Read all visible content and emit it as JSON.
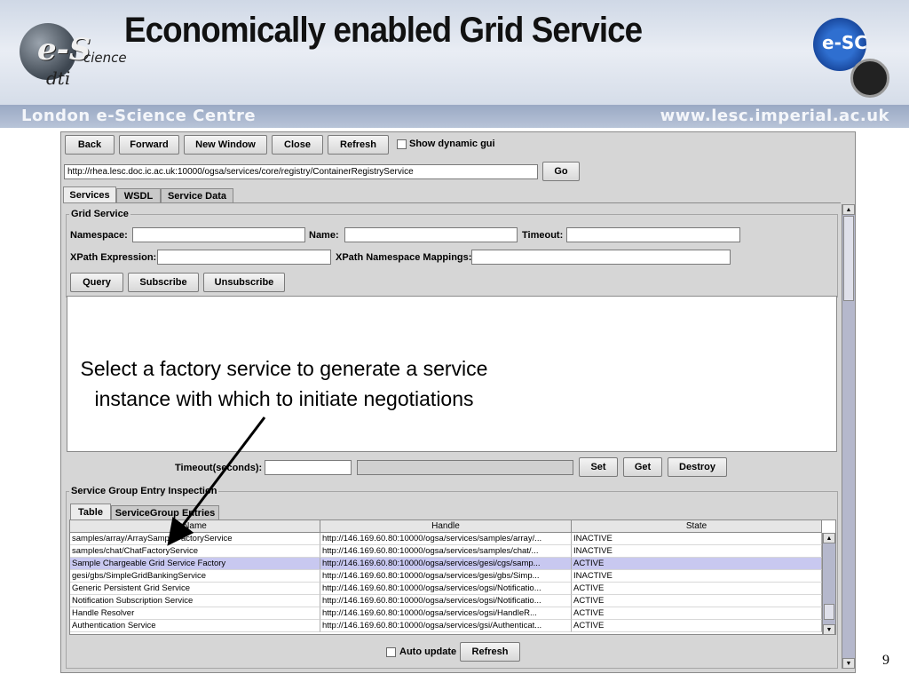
{
  "slide": {
    "title": "Economically enabled Grid Service",
    "strip_left": "London e-Science Centre",
    "strip_right": "www.lesc.imperial.ac.uk",
    "logo_left": {
      "es": "e-S",
      "cience": "cience",
      "dti": "dti"
    },
    "logo_right": {
      "esc": "e-SC",
      "icenitext": "ICENI"
    },
    "annotation_line1": "Select a factory service to generate a service",
    "annotation_line2": "instance with which to initiate negotiations",
    "page_number": "9"
  },
  "toolbar": {
    "back": "Back",
    "forward": "Forward",
    "new_window": "New Window",
    "close": "Close",
    "refresh": "Refresh",
    "show_dynamic_gui": "Show dynamic gui"
  },
  "address": {
    "url": "http://rhea.lesc.doc.ic.ac.uk:10000/ogsa/services/core/registry/ContainerRegistryService",
    "go": "Go"
  },
  "tabs": [
    "Services",
    "WSDL",
    "Service Data"
  ],
  "grid_service": {
    "title": "Grid Service",
    "namespace_label": "Namespace:",
    "name_label": "Name:",
    "timeout_label": "Timeout:",
    "xpath_label": "XPath Expression:",
    "xpath_ns_label": "XPath Namespace Mappings:",
    "query": "Query",
    "subscribe": "Subscribe",
    "unsubscribe": "Unsubscribe"
  },
  "timeout_bar": {
    "label": "Timeout(seconds):",
    "set": "Set",
    "get": "Get",
    "destroy": "Destroy"
  },
  "inspection": {
    "title": "Service Group Entry Inspection",
    "tabs": [
      "Table",
      "ServiceGroup Entries"
    ],
    "columns": [
      "Name",
      "Handle",
      "State"
    ],
    "rows": [
      {
        "name": "samples/array/ArraySampleFactoryService",
        "handle": "http://146.169.60.80:10000/ogsa/services/samples/array/...",
        "state": "INACTIVE"
      },
      {
        "name": "samples/chat/ChatFactoryService",
        "handle": "http://146.169.60.80:10000/ogsa/services/samples/chat/...",
        "state": "INACTIVE"
      },
      {
        "name": "Sample Chargeable Grid Service Factory",
        "handle": "http://146.169.60.80:10000/ogsa/services/gesi/cgs/samp...",
        "state": "ACTIVE"
      },
      {
        "name": "gesi/gbs/SimpleGridBankingService",
        "handle": "http://146.169.60.80:10000/ogsa/services/gesi/gbs/Simp...",
        "state": "INACTIVE"
      },
      {
        "name": "Generic Persistent Grid Service",
        "handle": "http://146.169.60.80:10000/ogsa/services/ogsi/Notificatio...",
        "state": "ACTIVE"
      },
      {
        "name": "Notification Subscription Service",
        "handle": "http://146.169.60.80:10000/ogsa/services/ogsi/Notificatio...",
        "state": "ACTIVE"
      },
      {
        "name": "Handle Resolver",
        "handle": "http://146.169.60.80:10000/ogsa/services/ogsi/HandleR...",
        "state": "ACTIVE"
      },
      {
        "name": "Authentication Service",
        "handle": "http://146.169.60.80:10000/ogsa/services/gsi/Authenticat...",
        "state": "ACTIVE"
      }
    ],
    "auto_update": "Auto update",
    "refresh": "Refresh"
  }
}
